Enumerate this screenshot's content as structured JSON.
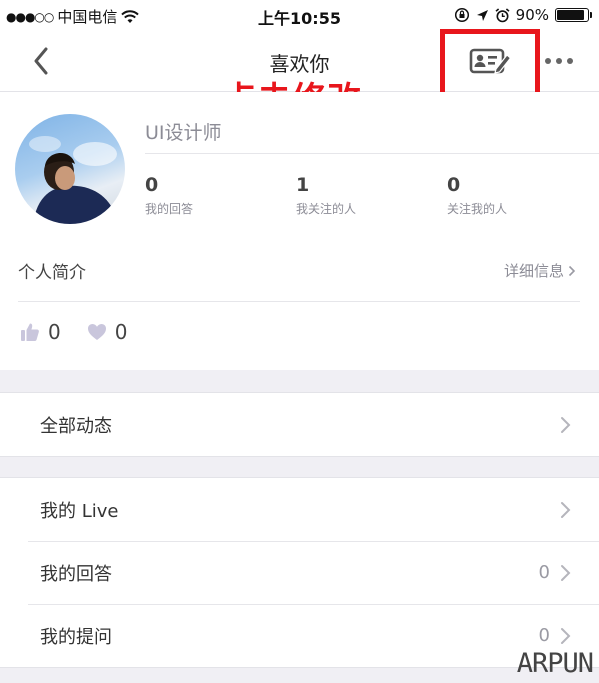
{
  "status_bar": {
    "carrier": "中国电信",
    "time": "上午10:55",
    "battery": "90%",
    "battery_level": 0.9
  },
  "nav": {
    "title": "喜欢你",
    "back_icon": "chevron-left-icon",
    "edit_icon": "profile-card-edit-icon",
    "more_icon": "more-dots-icon"
  },
  "annotation": {
    "text": "点击修改→",
    "color": "#e8161c"
  },
  "profile": {
    "name": "UI设计师",
    "stats": [
      {
        "value": "0",
        "label": "我的回答"
      },
      {
        "value": "1",
        "label": "我关注的人"
      },
      {
        "value": "0",
        "label": "关注我的人"
      }
    ],
    "intro_label": "个人简介",
    "intro_detail": "详细信息",
    "likes": "0",
    "hearts": "0"
  },
  "sections": {
    "activity": {
      "label": "全部动态"
    },
    "menu": [
      {
        "label": "我的 Live",
        "count": ""
      },
      {
        "label": "我的回答",
        "count": "0"
      },
      {
        "label": "我的提问",
        "count": "0"
      }
    ]
  },
  "watermark": "ARPUN",
  "colors": {
    "background": "#f0eff4",
    "accent_red": "#e8161c",
    "secondary_text": "#8c8c96"
  }
}
